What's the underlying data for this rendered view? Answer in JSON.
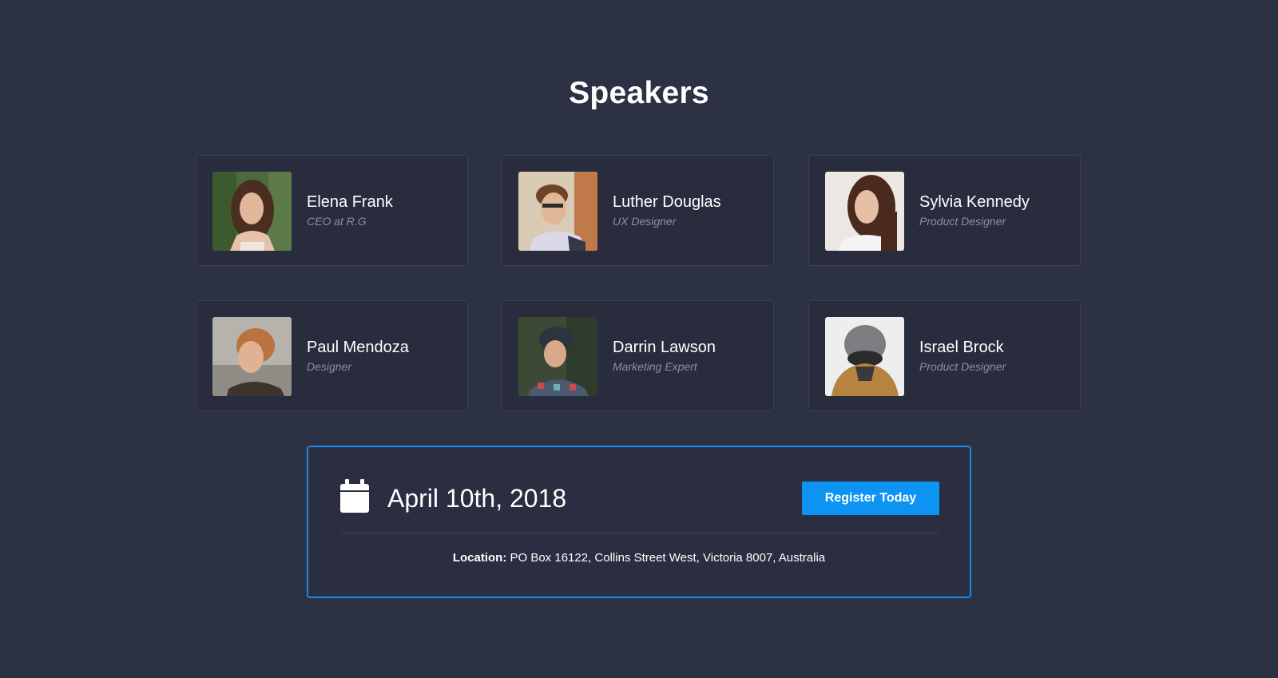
{
  "page": {
    "title": "Speakers"
  },
  "speakers": [
    {
      "name": "Elena Frank",
      "role": "CEO at R.G"
    },
    {
      "name": "Luther Douglas",
      "role": "UX Designer"
    },
    {
      "name": "Sylvia Kennedy",
      "role": "Product Designer"
    },
    {
      "name": "Paul Mendoza",
      "role": "Designer"
    },
    {
      "name": "Darrin Lawson",
      "role": "Marketing Expert"
    },
    {
      "name": "Israel Brock",
      "role": "Product Designer"
    }
  ],
  "event": {
    "icon": "calendar-icon",
    "date": "April 10th, 2018",
    "register_label": "Register Today",
    "location_label": "Location:",
    "location_value": "PO Box 16122, Collins Street West, Victoria 8007, Australia"
  },
  "colors": {
    "background": "#2d3144",
    "card": "#282c3c",
    "accent": "#0d93f2",
    "muted_text": "#8a8fa3"
  }
}
